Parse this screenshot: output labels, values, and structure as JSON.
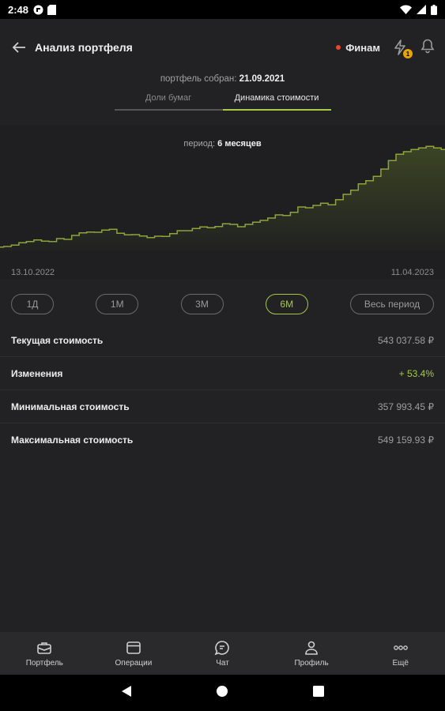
{
  "status_bar": {
    "time": "2:48"
  },
  "header": {
    "title": "Анализ портфеля",
    "broker": "Финам",
    "notification_count": "1"
  },
  "portfolio": {
    "collected_label": "портфель собран:",
    "collected_date": "21.09.2021"
  },
  "tabs": [
    {
      "label": "Доли бумаг",
      "active": false
    },
    {
      "label": "Динамика стоимости",
      "active": true
    }
  ],
  "period": {
    "label": "период:",
    "value": "6 месяцев"
  },
  "chart_data": {
    "type": "area",
    "x_start": "13.10.2022",
    "x_end": "11.04.2023",
    "values": [
      357993,
      359000,
      361500,
      366000,
      368500,
      371500,
      369000,
      368500,
      374000,
      372500,
      380000,
      385000,
      386500,
      386000,
      390000,
      391500,
      384000,
      381000,
      381500,
      379000,
      376000,
      378500,
      378000,
      383500,
      389000,
      389000,
      393000,
      396000,
      394500,
      397000,
      402000,
      401000,
      396500,
      401000,
      405000,
      408500,
      413000,
      419000,
      418000,
      424000,
      434000,
      432500,
      437000,
      441000,
      438000,
      448000,
      458000,
      466000,
      478000,
      484000,
      492000,
      506000,
      522000,
      534000,
      539000,
      543000,
      546000,
      549159,
      546000,
      543037
    ],
    "ylim": [
      350000,
      575000
    ],
    "grid": false,
    "line_color": "#8ea33c"
  },
  "ranges": [
    {
      "label": "1Д",
      "active": false
    },
    {
      "label": "1М",
      "active": false
    },
    {
      "label": "3М",
      "active": false
    },
    {
      "label": "6М",
      "active": true
    },
    {
      "label": "Весь период",
      "active": false
    }
  ],
  "stats": [
    {
      "label": "Текущая стоимость",
      "value": "543 037.58 ₽",
      "positive": false
    },
    {
      "label": "Изменения",
      "value": "+ 53.4%",
      "positive": true
    },
    {
      "label": "Минимальная стоимость",
      "value": "357 993.45 ₽",
      "positive": false
    },
    {
      "label": "Максимальная стоимость",
      "value": "549 159.93 ₽",
      "positive": false
    }
  ],
  "bottom_nav": [
    {
      "label": "Портфель",
      "icon": "briefcase-icon"
    },
    {
      "label": "Операции",
      "icon": "card-icon"
    },
    {
      "label": "Чат",
      "icon": "chat-icon"
    },
    {
      "label": "Профиль",
      "icon": "person-icon"
    },
    {
      "label": "Ещё",
      "icon": "more-icon"
    }
  ],
  "colors": {
    "accent": "#a6c94a",
    "background": "#222224",
    "broker_dot": "#f0442a",
    "badge": "#e8a400"
  }
}
